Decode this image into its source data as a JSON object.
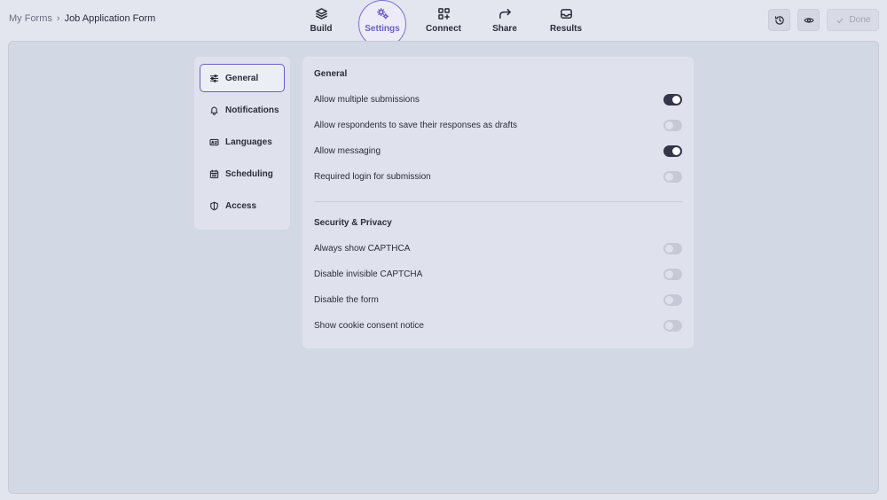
{
  "breadcrumb": {
    "root": "My Forms",
    "separator": "›",
    "current": "Job Application Form"
  },
  "nav": {
    "active": "settings",
    "items": [
      {
        "id": "build",
        "label": "Build",
        "icon": "layers-icon"
      },
      {
        "id": "settings",
        "label": "Settings",
        "icon": "gears-icon"
      },
      {
        "id": "connect",
        "label": "Connect",
        "icon": "grid-plus-icon"
      },
      {
        "id": "share",
        "label": "Share",
        "icon": "share-arrow-icon"
      },
      {
        "id": "results",
        "label": "Results",
        "icon": "inbox-icon"
      }
    ]
  },
  "actions": {
    "done_label": "Done",
    "history_icon": "history-icon",
    "preview_icon": "eye-icon",
    "done_icon": "check-icon"
  },
  "sidebar": {
    "items": [
      {
        "label": "General",
        "icon": "sliders-icon",
        "active": true
      },
      {
        "label": "Notifications",
        "icon": "bell-icon",
        "active": false
      },
      {
        "label": "Languages",
        "icon": "language-icon",
        "active": false
      },
      {
        "label": "Scheduling",
        "icon": "calendar-icon",
        "active": false
      },
      {
        "label": "Access",
        "icon": "shield-icon",
        "active": false
      }
    ]
  },
  "general": {
    "title": "General",
    "settings": [
      {
        "label": "Allow multiple submissions",
        "enabled": true
      },
      {
        "label": "Allow respondents to save their responses as drafts",
        "enabled": false
      },
      {
        "label": "Allow messaging",
        "enabled": true
      },
      {
        "label": "Required login for submission",
        "enabled": false
      }
    ]
  },
  "security": {
    "title": "Security & Privacy",
    "settings": [
      {
        "label": "Always show CAPTHCA",
        "enabled": false
      },
      {
        "label": "Disable invisible CAPTCHA",
        "enabled": false
      },
      {
        "label": "Disable the form",
        "enabled": false
      },
      {
        "label": "Show cookie consent notice",
        "enabled": false
      }
    ]
  },
  "colors": {
    "accent": "#6a5fc9",
    "toggle_on": "#33364a",
    "toggle_off": "#c6cad6",
    "canvas": "#d3d8e5"
  }
}
